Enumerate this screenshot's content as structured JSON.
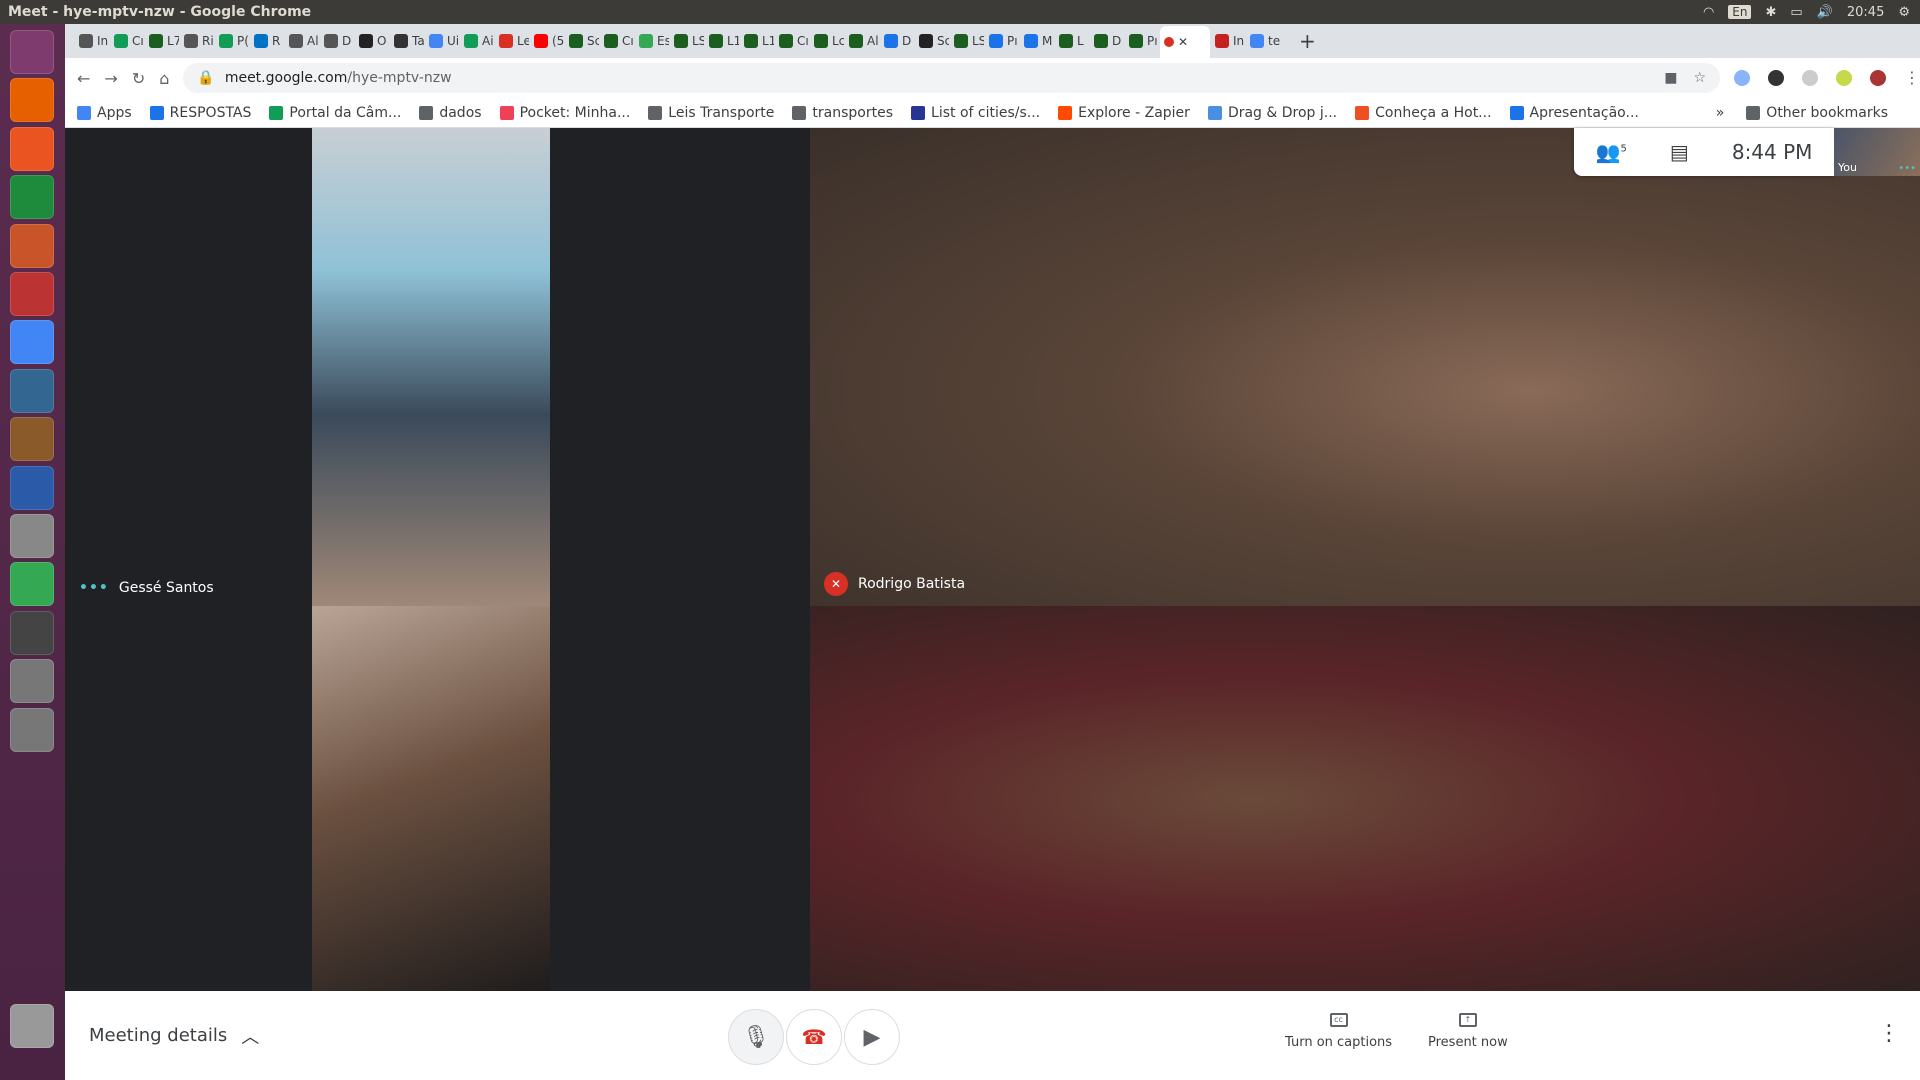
{
  "os": {
    "window_title": "Meet - hye-mptv-nzw - Google Chrome",
    "language": "En",
    "clock": "20:45"
  },
  "launcher": {
    "apps": [
      {
        "name": "ubuntu-dash-icon",
        "color": "#7d3b6e"
      },
      {
        "name": "firefox-icon",
        "color": "#e66000"
      },
      {
        "name": "software-center-icon",
        "color": "#e95420"
      },
      {
        "name": "calc-icon",
        "color": "#1d8a3c"
      },
      {
        "name": "impress-icon",
        "color": "#c9542a"
      },
      {
        "name": "system-settings-icon",
        "color": "#b33"
      },
      {
        "name": "chrome-icon",
        "color": "#4285f4"
      },
      {
        "name": "postgres-icon",
        "color": "#336791"
      },
      {
        "name": "archive-icon",
        "color": "#8a5a2b"
      },
      {
        "name": "writer-icon",
        "color": "#2a5aa8"
      },
      {
        "name": "text-editor-icon",
        "color": "#888"
      },
      {
        "name": "chrome-2-icon",
        "color": "#34a853"
      },
      {
        "name": "updater-icon",
        "color": "#444"
      },
      {
        "name": "camera-icon",
        "color": "#777"
      },
      {
        "name": "camera-2-icon",
        "color": "#777"
      },
      {
        "name": "trash-icon",
        "color": "#999"
      }
    ]
  },
  "browser": {
    "tabs": [
      {
        "label": "In",
        "color": "#555"
      },
      {
        "label": "Cı",
        "color": "#0f9d58"
      },
      {
        "label": "L7",
        "color": "#1b5e20"
      },
      {
        "label": "Ri",
        "color": "#555"
      },
      {
        "label": "P(",
        "color": "#0f9d58"
      },
      {
        "label": "R",
        "color": "#0072c6"
      },
      {
        "label": "Al",
        "color": "#555"
      },
      {
        "label": "D",
        "color": "#555"
      },
      {
        "label": "O",
        "color": "#222"
      },
      {
        "label": "Ta",
        "color": "#333"
      },
      {
        "label": "Ui",
        "color": "#4285f4"
      },
      {
        "label": "Ai",
        "color": "#0f9d58"
      },
      {
        "label": "Le",
        "color": "#d93025"
      },
      {
        "label": "(5",
        "color": "#ff0000"
      },
      {
        "label": "Sc",
        "color": "#1b5e20"
      },
      {
        "label": "Cı",
        "color": "#1b5e20"
      },
      {
        "label": "Es",
        "color": "#34a853"
      },
      {
        "label": "LS",
        "color": "#1b5e20"
      },
      {
        "label": "L1",
        "color": "#1b5e20"
      },
      {
        "label": "L1",
        "color": "#1b5e20"
      },
      {
        "label": "Cı",
        "color": "#1b5e20"
      },
      {
        "label": "Lc",
        "color": "#1b5e20"
      },
      {
        "label": "Al",
        "color": "#1b5e20"
      },
      {
        "label": "D",
        "color": "#1a73e8"
      },
      {
        "label": "Sc",
        "color": "#222"
      },
      {
        "label": "LS",
        "color": "#1b5e20"
      },
      {
        "label": "Pı",
        "color": "#1a73e8"
      },
      {
        "label": "M",
        "color": "#1a73e8"
      },
      {
        "label": "L",
        "color": "#1b5e20"
      },
      {
        "label": "D",
        "color": "#1b5e20"
      },
      {
        "label": "Pı",
        "color": "#1b5e20"
      }
    ],
    "active_tab": {
      "label": "",
      "color": "#d93025"
    },
    "tabs_after": [
      {
        "label": "In",
        "color": "#c5221f"
      },
      {
        "label": "te",
        "color": "#4285f4"
      }
    ],
    "new_tab": "+",
    "url_host": "meet.google.com",
    "url_path": "/hye-mptv-nzw",
    "bookmarks": [
      {
        "label": "Apps",
        "color": "#4285f4"
      },
      {
        "label": "RESPOSTAS",
        "color": "#1a73e8"
      },
      {
        "label": "Portal da Câm...",
        "color": "#0f9d58"
      },
      {
        "label": "dados",
        "color": "#5f6368"
      },
      {
        "label": "Pocket: Minha...",
        "color": "#ef4056"
      },
      {
        "label": "Leis Transporte",
        "color": "#5f6368"
      },
      {
        "label": "transportes",
        "color": "#5f6368"
      },
      {
        "label": "List of cities/s...",
        "color": "#283593"
      },
      {
        "label": "Explore - Zapier",
        "color": "#ff4a00"
      },
      {
        "label": "Drag & Drop j...",
        "color": "#4a90e2"
      },
      {
        "label": "Conheça a Hot...",
        "color": "#f04e23"
      },
      {
        "label": "Apresentação...",
        "color": "#1a73e8"
      }
    ],
    "bookmarks_overflow": "»",
    "other_bookmarks": "Other bookmarks"
  },
  "meet": {
    "participants_count": "5",
    "time": "8:44 PM",
    "self_label": "You",
    "tiles": [
      {
        "name": "Gessé Santos",
        "status": "speaking"
      },
      {
        "name": "Rodrigo Batista",
        "status": "muted"
      },
      {
        "name": "",
        "status": ""
      },
      {
        "name": "",
        "status": ""
      }
    ],
    "meeting_details": "Meeting details",
    "captions_label": "Turn on captions",
    "present_label": "Present now"
  }
}
